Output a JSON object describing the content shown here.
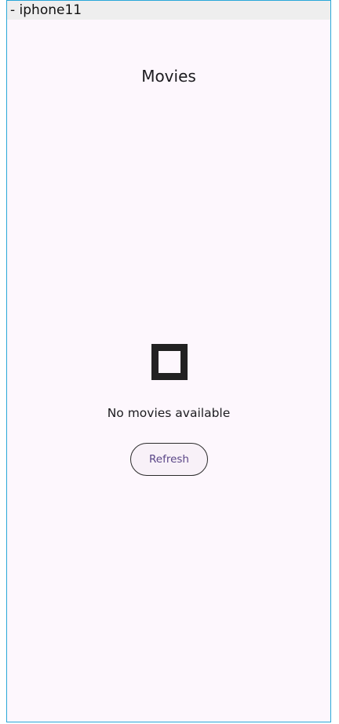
{
  "device_label": "- iphone11",
  "screen": {
    "title": "Movies",
    "empty_state": {
      "icon": "empty-square-icon",
      "message": "No movies available",
      "refresh_label": "Refresh"
    }
  },
  "colors": {
    "background": "#fdf7fd",
    "frame_border": "#2aa8d8",
    "button_text": "#5a4687",
    "icon": "#222222"
  }
}
